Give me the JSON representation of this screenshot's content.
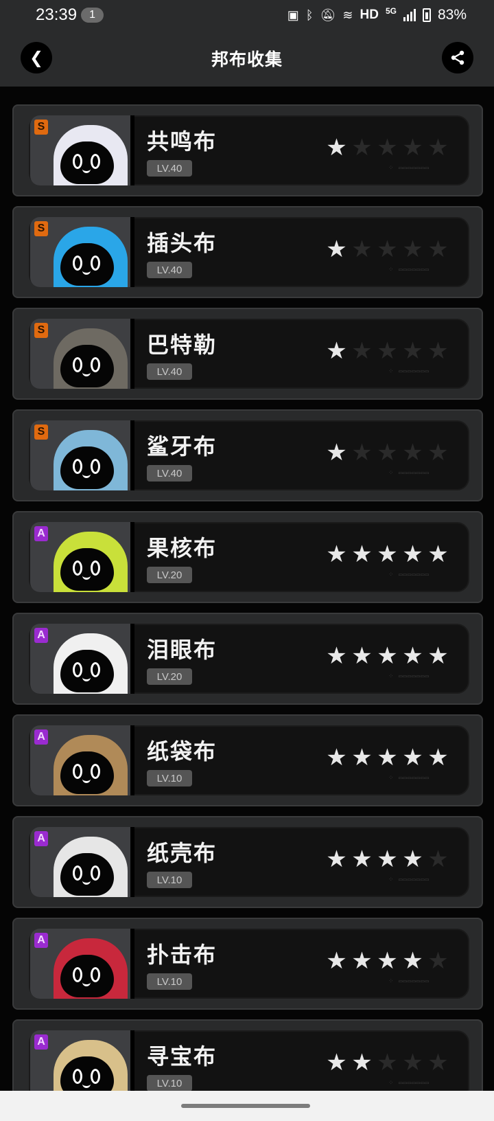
{
  "status_bar": {
    "time": "23:39",
    "notification_count": "1",
    "network": "HD",
    "network_gen": "5G",
    "battery": "83%"
  },
  "header": {
    "title": "邦布收集",
    "back_icon": "chevron-left-icon",
    "share_icon": "share-icon"
  },
  "bangboos": [
    {
      "name": "共鸣布",
      "level": "LV.40",
      "rank": "S",
      "stars": 1,
      "theme": "#e8e8f2"
    },
    {
      "name": "插头布",
      "level": "LV.40",
      "rank": "S",
      "stars": 1,
      "theme": "#2aa6e8"
    },
    {
      "name": "巴特勒",
      "level": "LV.40",
      "rank": "S",
      "stars": 1,
      "theme": "#6e6a62"
    },
    {
      "name": "鲨牙布",
      "level": "LV.40",
      "rank": "S",
      "stars": 1,
      "theme": "#7fb7d8"
    },
    {
      "name": "果核布",
      "level": "LV.20",
      "rank": "A",
      "stars": 5,
      "theme": "#c9e03a"
    },
    {
      "name": "泪眼布",
      "level": "LV.20",
      "rank": "A",
      "stars": 5,
      "theme": "#f0f0f0"
    },
    {
      "name": "纸袋布",
      "level": "LV.10",
      "rank": "A",
      "stars": 5,
      "theme": "#b08a58"
    },
    {
      "name": "纸壳布",
      "level": "LV.10",
      "rank": "A",
      "stars": 4,
      "theme": "#e6e6e6"
    },
    {
      "name": "扑击布",
      "level": "LV.10",
      "rank": "A",
      "stars": 4,
      "theme": "#c8283c"
    },
    {
      "name": "寻宝布",
      "level": "LV.10",
      "rank": "A",
      "stars": 2,
      "theme": "#d8c08a"
    }
  ],
  "max_stars": 5
}
